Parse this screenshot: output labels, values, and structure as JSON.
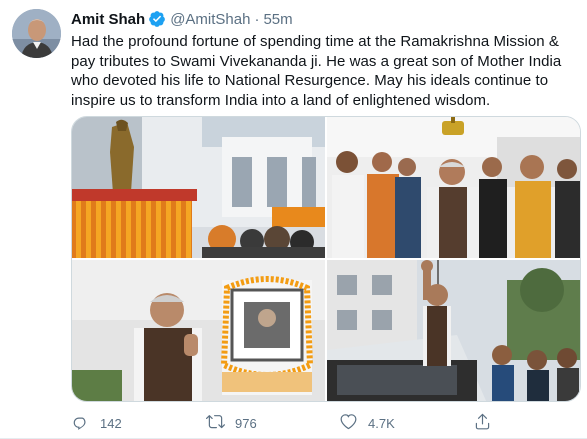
{
  "tweet": {
    "author_name": "Amit Shah",
    "handle": "@AmitShah",
    "separator": "·",
    "time": "55m",
    "text": "Had the profound fortune of spending time at the Ramakrishna Mission & pay tributes to Swami Vivekananda ji. He was a great son of Mother India who devoted his life to National Resurgence. May his ideals continue to inspire us to transform India into a land of enlightened wisdom."
  },
  "stats": {
    "replies": "142",
    "retweets": "976",
    "likes": "4.7K"
  },
  "icons": {
    "verified": "verified-badge-icon",
    "reply": "reply-icon",
    "retweet": "retweet-icon",
    "like": "heart-icon",
    "share": "share-icon"
  },
  "colors": {
    "accent": "#1da1f2",
    "muted_text": "#5b7083",
    "border": "#cfd9de"
  }
}
